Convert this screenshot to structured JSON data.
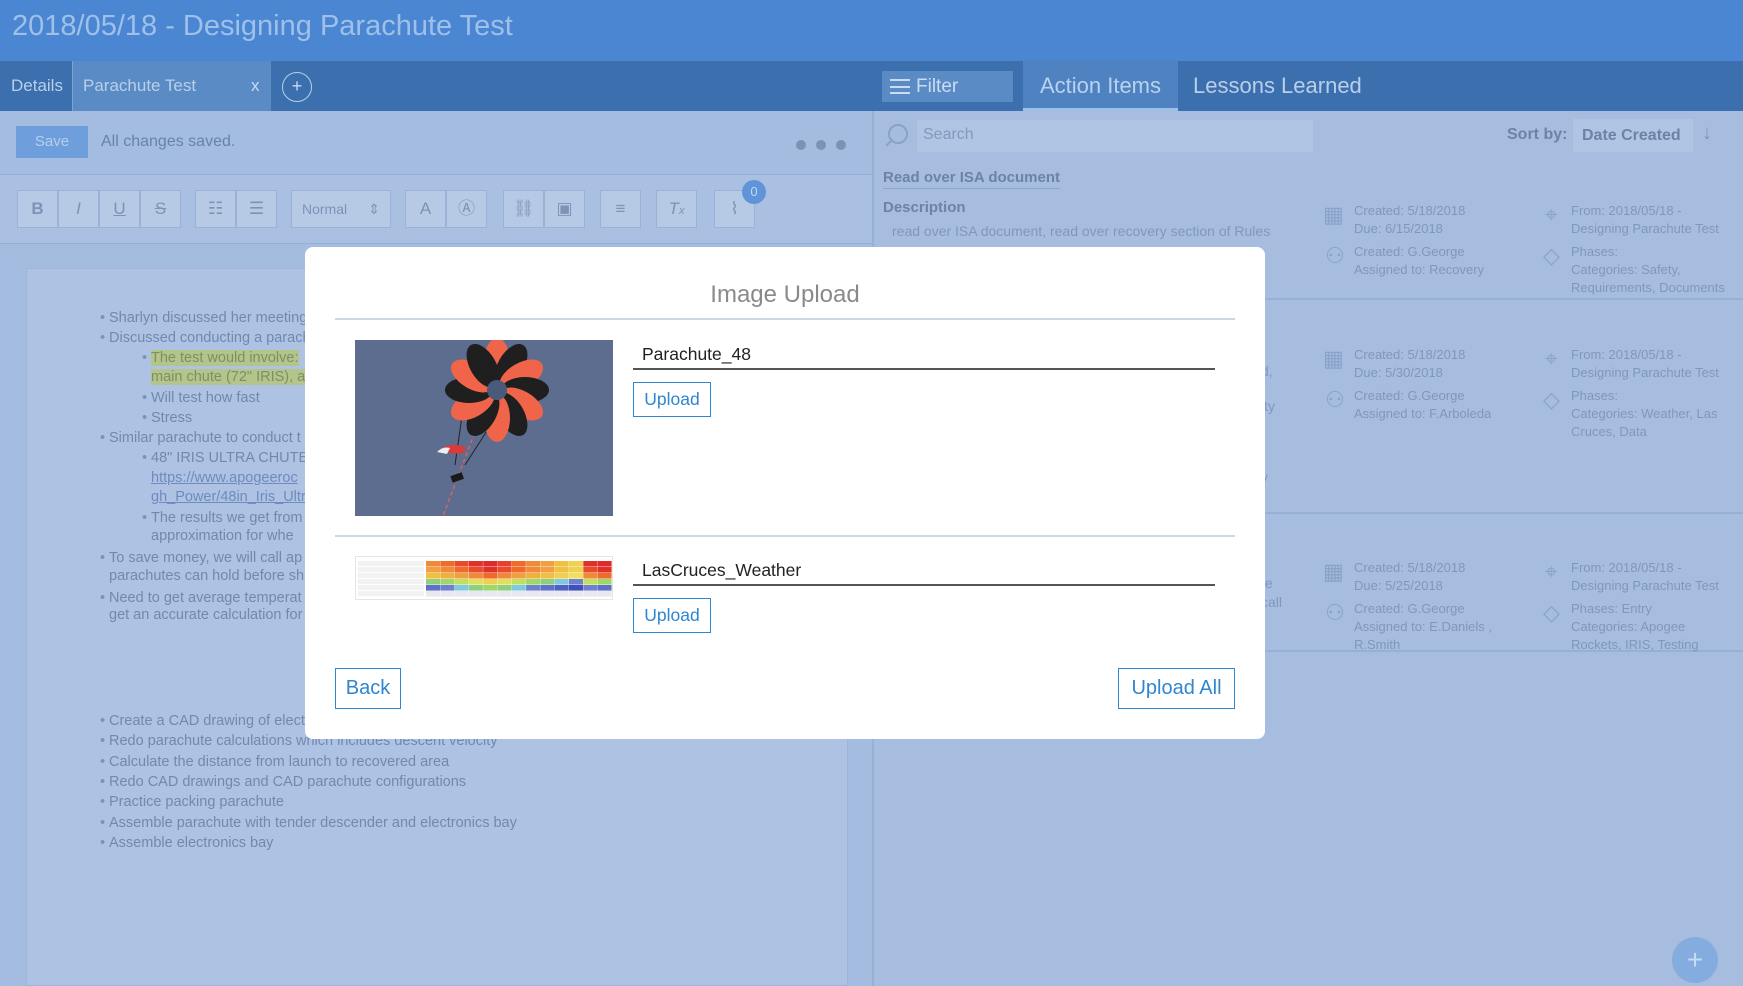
{
  "app": {
    "title": "2018/05/18 - Designing Parachute Test"
  },
  "tabs": {
    "details": "Details",
    "parachute": "Parachute Test",
    "close": "x",
    "add": "+"
  },
  "right_tabs": {
    "filter": "Filter",
    "action_items": "Action Items",
    "lessons_learned": "Lessons Learned"
  },
  "editor": {
    "save_label": "Save",
    "status": "All changes saved.",
    "toolbar": {
      "bold": "B",
      "italic": "I",
      "underline": "U",
      "strike": "S",
      "format": "Normal",
      "attachment_count": "0"
    },
    "lines": [
      {
        "text": "Sharlyn discussed her meeting",
        "indent": 0
      },
      {
        "text": "Discussed conducting a parach",
        "indent": 0
      },
      {
        "text": "The test would involve:",
        "indent": 1,
        "highlight": true
      },
      {
        "text": "main chute (72\" IRIS), at",
        "indent": 1,
        "highlight": true,
        "nobullet": true
      },
      {
        "text": "Will test how fast",
        "indent": 1
      },
      {
        "text": "Stress",
        "indent": 1
      },
      {
        "text": "Similar parachute to conduct t",
        "indent": 0
      },
      {
        "text": "48\" IRIS ULTRA CHUTE:",
        "indent": 1
      },
      {
        "text": "https://www.apogeeroc",
        "indent": 1,
        "link": true,
        "nobullet": true
      },
      {
        "text": "gh_Power/48in_Iris_Ultr",
        "indent": 1,
        "link": true,
        "nobullet": true
      },
      {
        "text": "The results we get from",
        "indent": 1
      },
      {
        "text": "approximation for whe",
        "indent": 1,
        "nobullet": true
      },
      {
        "text": "To save money, we will call ap",
        "indent": 0
      },
      {
        "text": "parachutes can hold before sh",
        "indent": 0,
        "nobullet": true
      },
      {
        "text": "Need to get average temperat",
        "indent": 0
      },
      {
        "text": "get an accurate calculation for",
        "indent": 0,
        "nobullet": true
      }
    ],
    "lines2": [
      "Create a CAD drawing of elect",
      "Redo parachute calculations which includes descent velocity",
      "Calculate the distance from launch to recovered area",
      "Redo CAD drawings and CAD parachute configurations",
      "Practice packing parachute",
      "Assemble parachute with tender descender and electronics bay",
      "Assemble electronics bay"
    ]
  },
  "action_items": {
    "search_placeholder": "Search",
    "sort_label": "Sort by:",
    "sort_value": "Date Created",
    "items": [
      {
        "title": "Read over ISA document",
        "description_label": "Description",
        "description": "read over ISA document, read over recovery section of Rules",
        "created_date": "Created: 5/18/2018",
        "due": "Due: 6/15/2018",
        "created_by": "Created: G.George",
        "assigned": "Assigned to: Recovery",
        "from1": "From: 2018/05/18 -",
        "from2": "Designing Parachute Test",
        "phases": "Phases:",
        "categories1": "Categories: Safety,",
        "categories2": "Requirements, Documents",
        "categories3": ""
      },
      {
        "title": "",
        "description_label": "",
        "description": "",
        "created_date": "Created: 5/18/2018",
        "due": "Due: 5/30/2018",
        "created_by": "Created: G.George",
        "assigned": "Assigned to: F.Arboleda",
        "from1": "From: 2018/05/18 -",
        "from2": "Designing Parachute Test",
        "phases": "Phases:",
        "categories1": "Categories: Weather, Las",
        "categories2": "Cruces, Data",
        "categories3": ""
      },
      {
        "title": "",
        "description_label": "",
        "description": "",
        "created_date": "Created: 5/18/2018",
        "due": "Due: 5/25/2018",
        "created_by": "Created: G.George",
        "assigned": "Assigned to: E.Daniels ,",
        "assigned2": "R.Smith",
        "from1": "From: 2018/05/18 -",
        "from2": "Designing Parachute Test",
        "phases": "Phases: Entry",
        "categories1": "Categories: Apogee",
        "categories2": "Rockets, IRIS, Testing",
        "categories3": ""
      }
    ],
    "clipped_fragments": [
      "d,",
      "ity",
      "y",
      "te",
      "call"
    ]
  },
  "modal": {
    "title": "Image Upload",
    "images": [
      {
        "name": "Parachute_48",
        "upload_label": "Upload"
      },
      {
        "name": "LasCruces_Weather",
        "upload_label": "Upload"
      }
    ],
    "back_label": "Back",
    "upload_all_label": "Upload All"
  },
  "colors": {
    "accent": "#2f86d1",
    "header": "#4a86d2",
    "overlay": "#a6bde0"
  }
}
